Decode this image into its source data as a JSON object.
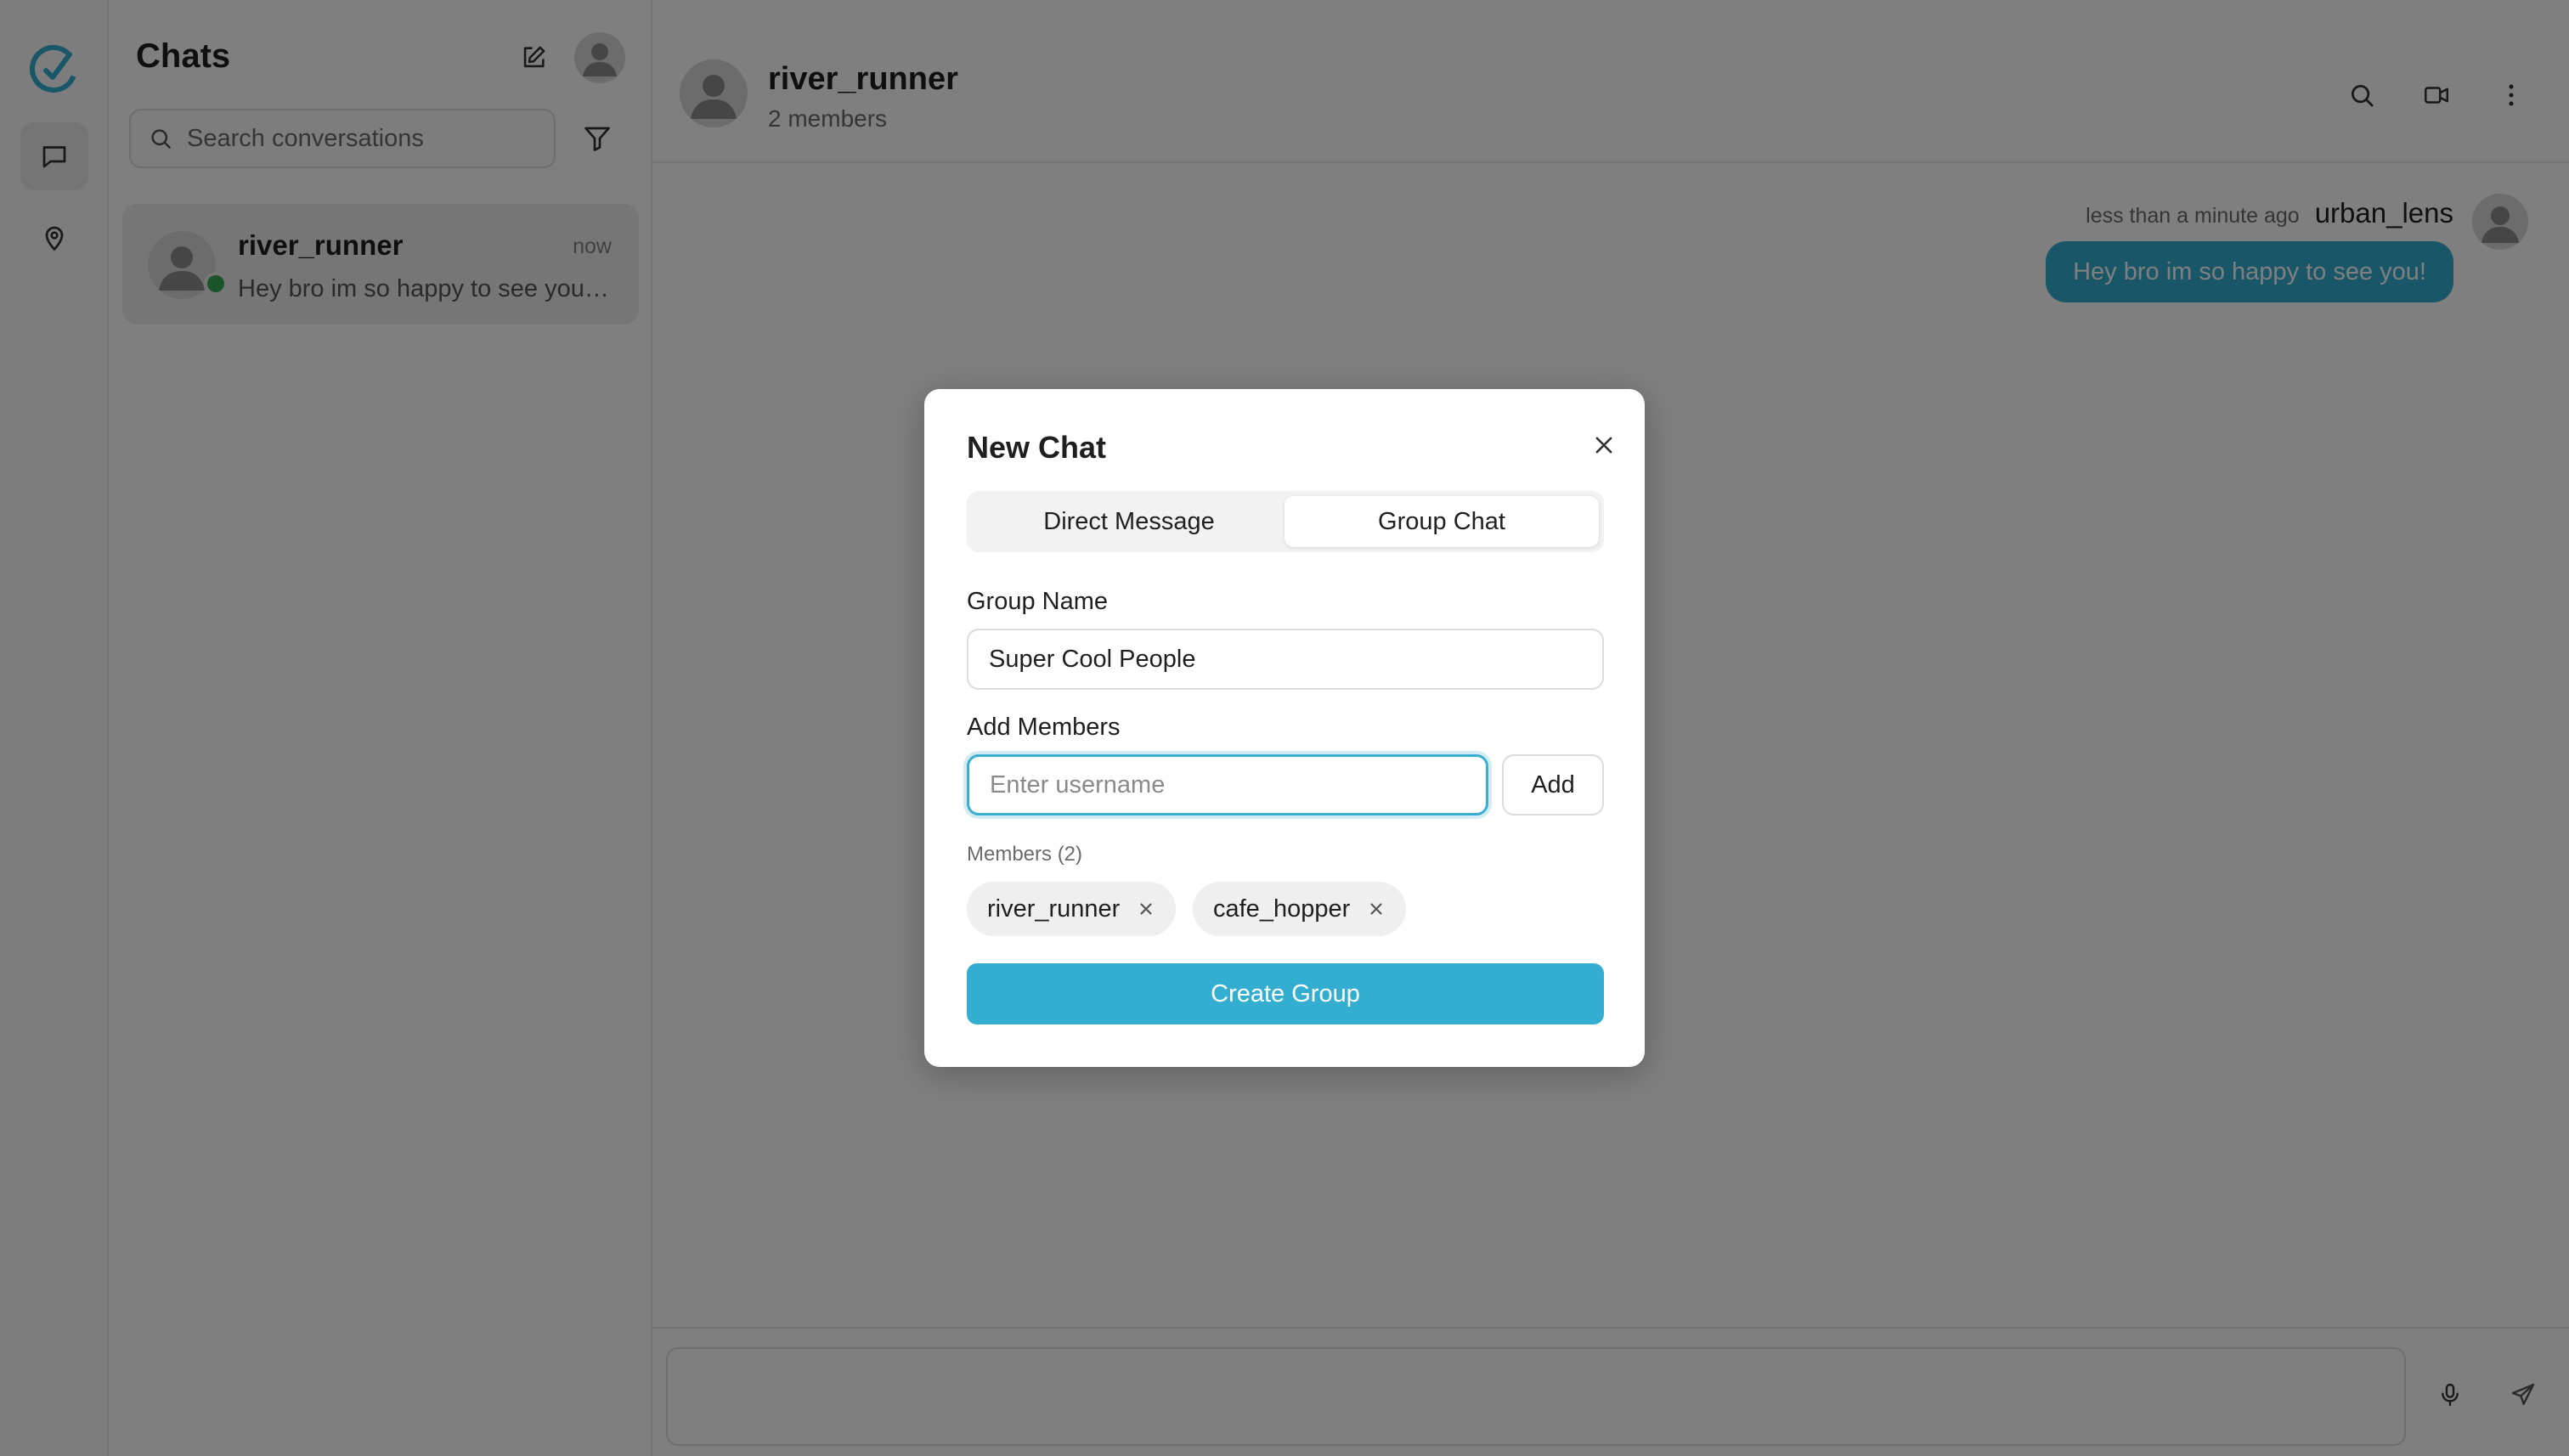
{
  "app": {
    "accent_color": "#33aed0",
    "online_color": "#34a853"
  },
  "rail": {
    "logo_icon": "app-logo-icon",
    "items": [
      {
        "icon": "chat-bubble-icon",
        "active": true
      },
      {
        "icon": "map-pin-icon",
        "active": false
      }
    ]
  },
  "list": {
    "title": "Chats",
    "search_placeholder": "Search conversations",
    "conversations": [
      {
        "name": "river_runner",
        "time": "now",
        "preview": "Hey bro im so happy to see you!...",
        "online": true
      }
    ]
  },
  "chat": {
    "name": "river_runner",
    "subtitle": "2 members",
    "messages": [
      {
        "sender": "urban_lens",
        "time": "less than a minute ago",
        "text": "Hey bro im so happy to see you!"
      }
    ],
    "composer_placeholder": ""
  },
  "modal": {
    "title": "New Chat",
    "tabs": [
      {
        "label": "Direct Message",
        "selected": false
      },
      {
        "label": "Group Chat",
        "selected": true
      }
    ],
    "group_name_label": "Group Name",
    "group_name_value": "Super Cool People",
    "add_members_label": "Add Members",
    "username_placeholder": "Enter username",
    "add_button": "Add",
    "members_label": "Members (2)",
    "members": [
      "river_runner",
      "cafe_hopper"
    ],
    "create_button": "Create Group"
  }
}
